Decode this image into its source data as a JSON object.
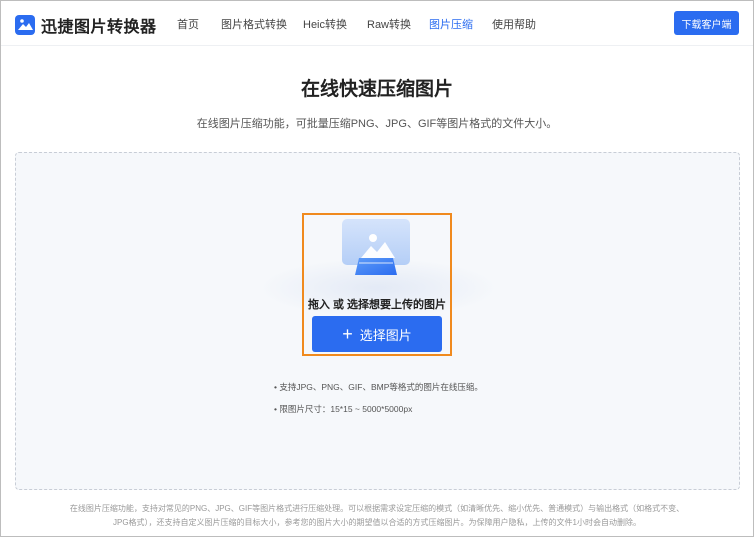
{
  "app": {
    "logo_icon": "image-icon",
    "name": "迅捷图片转换器",
    "accent_color": "#2b6cf0"
  },
  "nav": {
    "items": [
      {
        "label": "首页",
        "active": false
      },
      {
        "label": "图片格式转换",
        "active": false
      },
      {
        "label": "Heic转换",
        "active": false
      },
      {
        "label": "Raw转换",
        "active": false
      },
      {
        "label": "图片压缩",
        "active": true
      },
      {
        "label": "使用帮助",
        "active": false
      }
    ],
    "download_label": "下载客户端"
  },
  "main": {
    "title": "在线快速压缩图片",
    "subtitle": "在线图片压缩功能，可批量压缩PNG、JPG、GIF等图片格式的文件大小。"
  },
  "upload": {
    "drop_text": "拖入 或 选择想要上传的图片",
    "button_icon": "plus-icon",
    "button_label": "选择图片",
    "highlight_color": "#f08a1e",
    "hints": [
      "• 支持JPG、PNG、GIF、BMP等格式的图片在线压缩。",
      "• 限图片尺寸：15*15 ~ 5000*5000px"
    ]
  },
  "footer": {
    "line1": "在线图片压缩功能，支持对常见的PNG、JPG、GIF等图片格式进行压缩处理。可以根据需求设定压缩的模式（如清晰优先、缩小优先、普通模式）与输出格式（如格式不变、",
    "line2": "JPG格式），还支持自定义图片压缩的目标大小，参考您的图片大小的期望值以合适的方式压缩图片。为保障用户隐私，上传的文件1小时会自动删除。"
  }
}
